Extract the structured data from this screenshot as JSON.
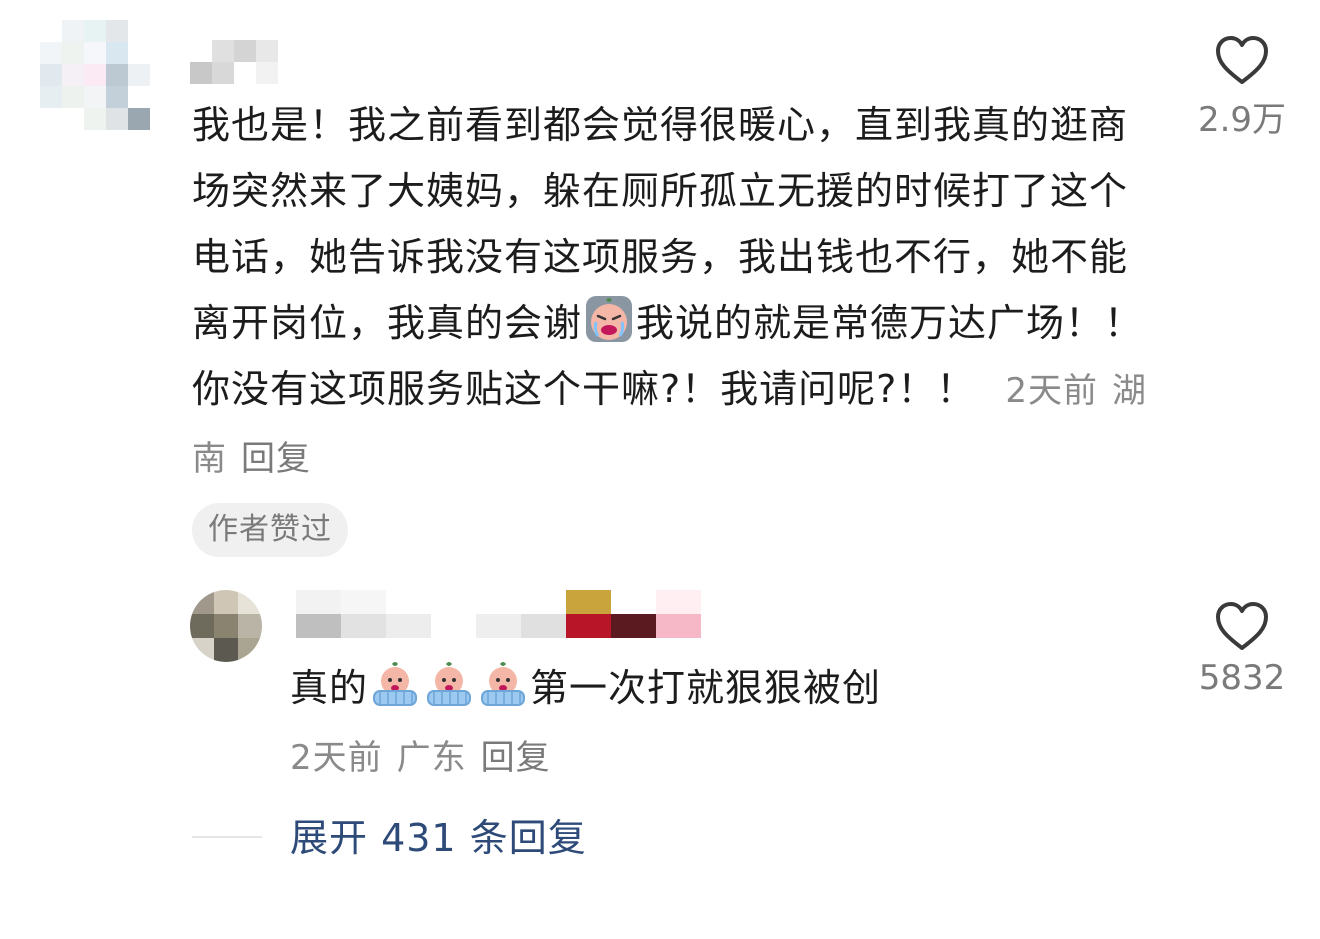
{
  "main_comment": {
    "text_part1": "我也是！我之前看到都会觉得很暖心，直到我真的逛商场突然来了大姨妈，躲在厕所孤立无援的时候打了这个电话，她告诉我没有这项服务，我出钱也不行，她不能离开岗位，我真的会谢",
    "emoji": "crying-face-emoji",
    "text_part2": "我说的就是常德万达广场！！你没有这项服务贴这个干嘛?！我请问呢?！！",
    "time": "2天前",
    "location": "湖南",
    "reply_label": "回复",
    "likes": "2.9万",
    "author_liked_badge": "作者赞过"
  },
  "reply_comment": {
    "text_prefix": "真的",
    "emojis": [
      "crying-in-bath-emoji",
      "crying-in-bath-emoji",
      "crying-in-bath-emoji"
    ],
    "text_suffix": "第一次打就狠狠被创",
    "time": "2天前",
    "location": "广东",
    "reply_label": "回复",
    "likes": "5832"
  },
  "expand": {
    "label": "展开 431 条回复"
  },
  "colors": {
    "text": "#1c1c1c",
    "meta": "#8a8a8a",
    "link": "#2d4a78",
    "badge_bg": "#f0f0f0"
  }
}
